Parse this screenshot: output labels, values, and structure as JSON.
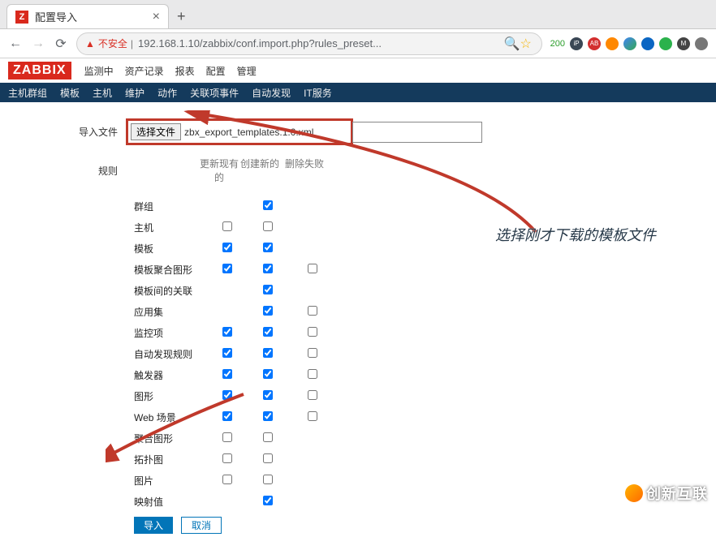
{
  "browser": {
    "tab_title": "配置导入",
    "favicon_letter": "Z",
    "insecure_label": "不安全",
    "url": "192.168.1.10/zabbix/conf.import.php?rules_preset...",
    "ext_num": "200"
  },
  "header": {
    "logo": "ZABBIX",
    "topnav": [
      "监测中",
      "资产记录",
      "报表",
      "配置",
      "管理"
    ],
    "subnav": [
      "主机群组",
      "模板",
      "主机",
      "维护",
      "动作",
      "关联项事件",
      "自动发现",
      "IT服务"
    ]
  },
  "form": {
    "file_label": "导入文件",
    "choose_file_btn": "选择文件",
    "file_name": "zbx_export_templates.1.0.xml",
    "rules_label": "规则",
    "col_update": "更新现有的",
    "col_create": "创建新的",
    "col_delete": "删除失败",
    "rows": [
      {
        "name": "群组",
        "update": null,
        "create": true,
        "delete": null
      },
      {
        "name": "主机",
        "update": false,
        "create": false,
        "delete": null
      },
      {
        "name": "模板",
        "update": true,
        "create": true,
        "delete": null
      },
      {
        "name": "模板聚合图形",
        "update": true,
        "create": true,
        "delete": false
      },
      {
        "name": "模板间的关联",
        "update": null,
        "create": true,
        "delete": null
      },
      {
        "name": "应用集",
        "update": null,
        "create": true,
        "delete": false
      },
      {
        "name": "监控项",
        "update": true,
        "create": true,
        "delete": false
      },
      {
        "name": "自动发现规则",
        "update": true,
        "create": true,
        "delete": false
      },
      {
        "name": "触发器",
        "update": true,
        "create": true,
        "delete": false
      },
      {
        "name": "图形",
        "update": true,
        "create": true,
        "delete": false
      },
      {
        "name": "Web 场景",
        "update": true,
        "create": true,
        "delete": false
      },
      {
        "name": "聚合图形",
        "update": false,
        "create": false,
        "delete": null
      },
      {
        "name": "拓扑图",
        "update": false,
        "create": false,
        "delete": null
      },
      {
        "name": "图片",
        "update": false,
        "create": false,
        "delete": null
      },
      {
        "name": "映射值",
        "update": null,
        "create": true,
        "delete": null
      }
    ],
    "submit": "导入",
    "cancel": "取消"
  },
  "annotation": "选择刚才下载的模板文件",
  "watermark": "创新互联"
}
